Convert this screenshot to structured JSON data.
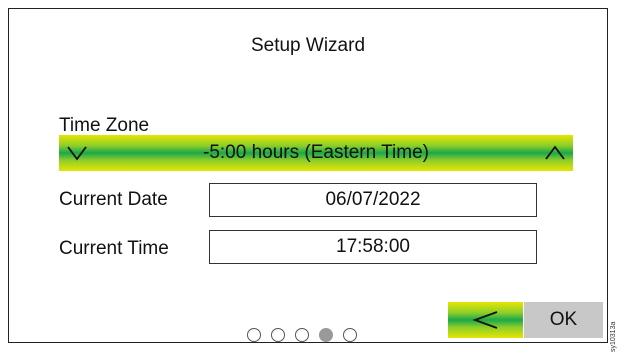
{
  "wizard": {
    "title": "Setup Wizard",
    "time_zone_label": "Time Zone",
    "time_zone_value": "-5:00 hours (Eastern Time)",
    "current_date_label": "Current Date",
    "current_date_value": "06/07/2022",
    "current_time_label": "Current Time",
    "current_time_value": "17:58:00",
    "pagination": {
      "total": 5,
      "active_index": 3
    },
    "ok_label": "OK",
    "icons": {
      "decrement": "chevron-down-icon",
      "increment": "chevron-up-icon",
      "back": "back-arrow-icon"
    }
  },
  "figure_code": "sy10313a",
  "colors": {
    "accent_yellow": "#e6e600",
    "accent_green": "#1aa84b",
    "ok_gray": "#c8c8c8"
  }
}
